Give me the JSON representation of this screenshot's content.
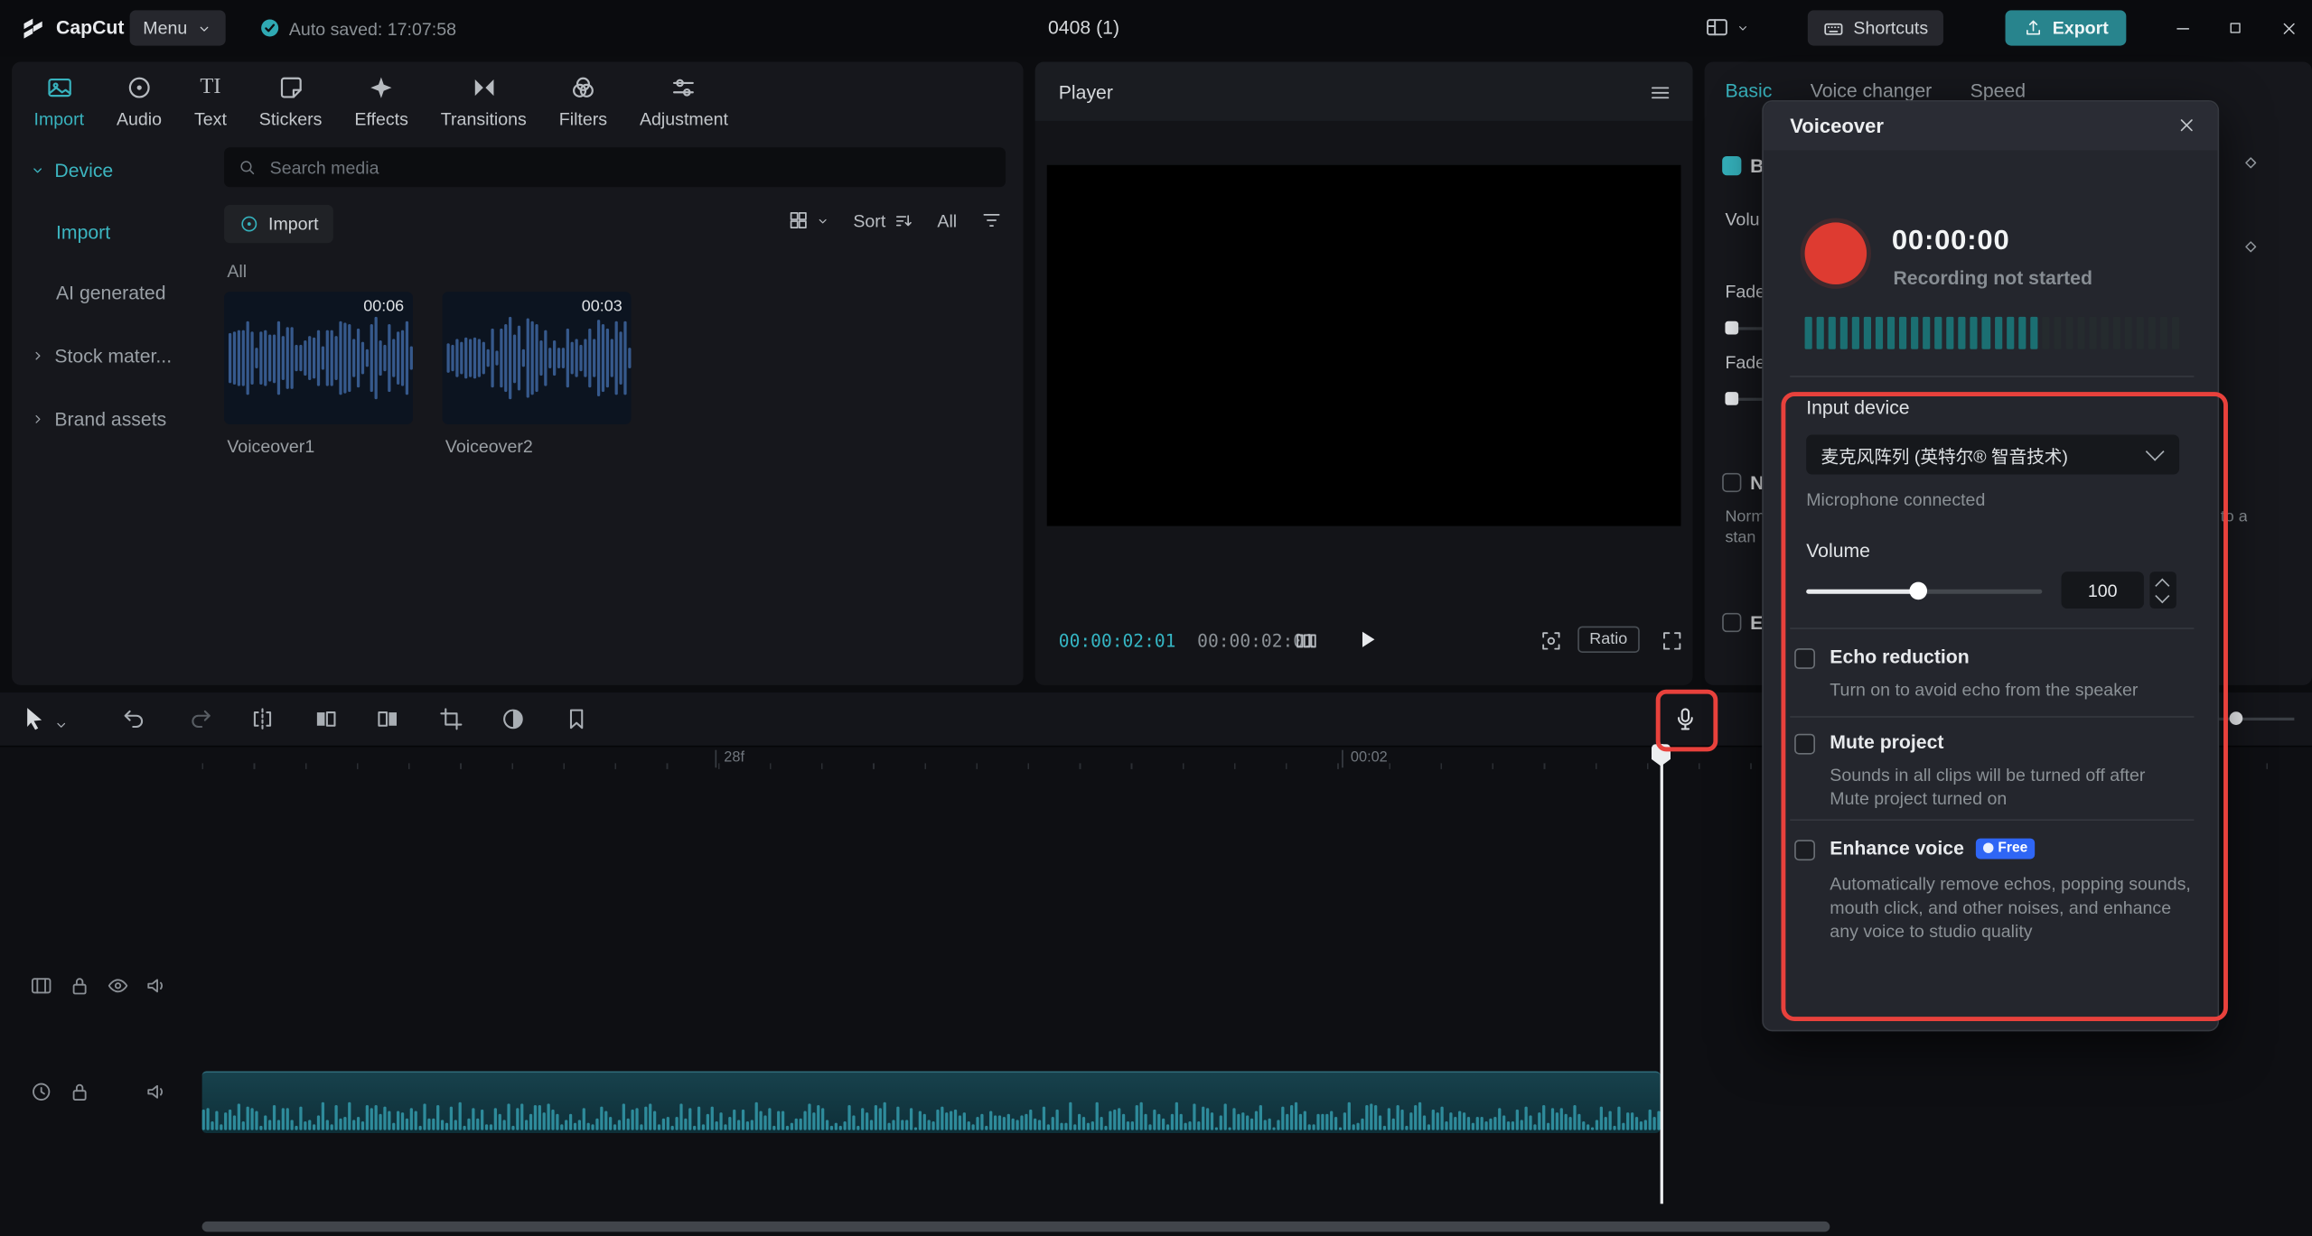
{
  "topbar": {
    "logo": "CapCut",
    "menu": "Menu",
    "autosave": "Auto saved: 17:07:58",
    "title": "0408 (1)",
    "shortcuts": "Shortcuts",
    "export": "Export"
  },
  "media": {
    "tabs": [
      "Import",
      "Audio",
      "Text",
      "Stickers",
      "Effects",
      "Transitions",
      "Filters",
      "Adjustment"
    ],
    "text_tab_glyph": "TI",
    "sidebar": [
      {
        "label": "Device"
      },
      {
        "label": "Import"
      },
      {
        "label": "AI generated"
      },
      {
        "label": "Stock mater..."
      },
      {
        "label": "Brand assets"
      }
    ],
    "search_placeholder": "Search media",
    "import_button": "Import",
    "sort": "Sort",
    "all_filter": "All",
    "section": "All",
    "clips": [
      {
        "name": "Voiceover1",
        "duration": "00:06"
      },
      {
        "name": "Voiceover2",
        "duration": "00:03"
      }
    ]
  },
  "player": {
    "title": "Player",
    "current": "00:00:02:01",
    "duration": "00:00:02:01",
    "ratio": "Ratio"
  },
  "inspector": {
    "tabs": [
      "Basic",
      "Voice changer",
      "Speed"
    ],
    "partials": {
      "basic_check": "B",
      "volume": "Volu",
      "fade_in": "Fade",
      "fade_out": "Fade",
      "normalize_check": "N",
      "norm_line1": "Norm",
      "norm_line2": "stan",
      "enhance_check": "E",
      "right_fragment": "to a"
    }
  },
  "dialog": {
    "title": "Voiceover",
    "time": "00:00:00",
    "status": "Recording not started",
    "input_device_label": "Input device",
    "input_device": "麦克风阵列 (英特尔® 智音技术)",
    "mic_status": "Microphone connected",
    "volume_label": "Volume",
    "volume_value": "100",
    "meter": {
      "total": 32,
      "lit": 20
    },
    "options": [
      {
        "title": "Echo reduction",
        "desc": "Turn on to avoid echo from the speaker"
      },
      {
        "title": "Mute project",
        "desc": "Sounds in all clips will be turned off after Mute project turned on"
      },
      {
        "title": "Enhance voice",
        "badge": "Free",
        "desc": "Automatically remove echos, popping sounds, mouth click, and other noises, and enhance any voice to studio quality"
      }
    ]
  },
  "timeline": {
    "ruler": [
      {
        "label": "28f"
      },
      {
        "label": "00:02"
      }
    ]
  },
  "decor": {
    "waves": {
      "thumb1": {
        "bars": 42,
        "seed": 11,
        "min": 15,
        "max": 88
      },
      "thumb2": {
        "bars": 42,
        "seed": 29,
        "min": 15,
        "max": 88
      },
      "clip": {
        "bars": 330,
        "seed": 5,
        "min": 12,
        "max": 96
      }
    }
  }
}
